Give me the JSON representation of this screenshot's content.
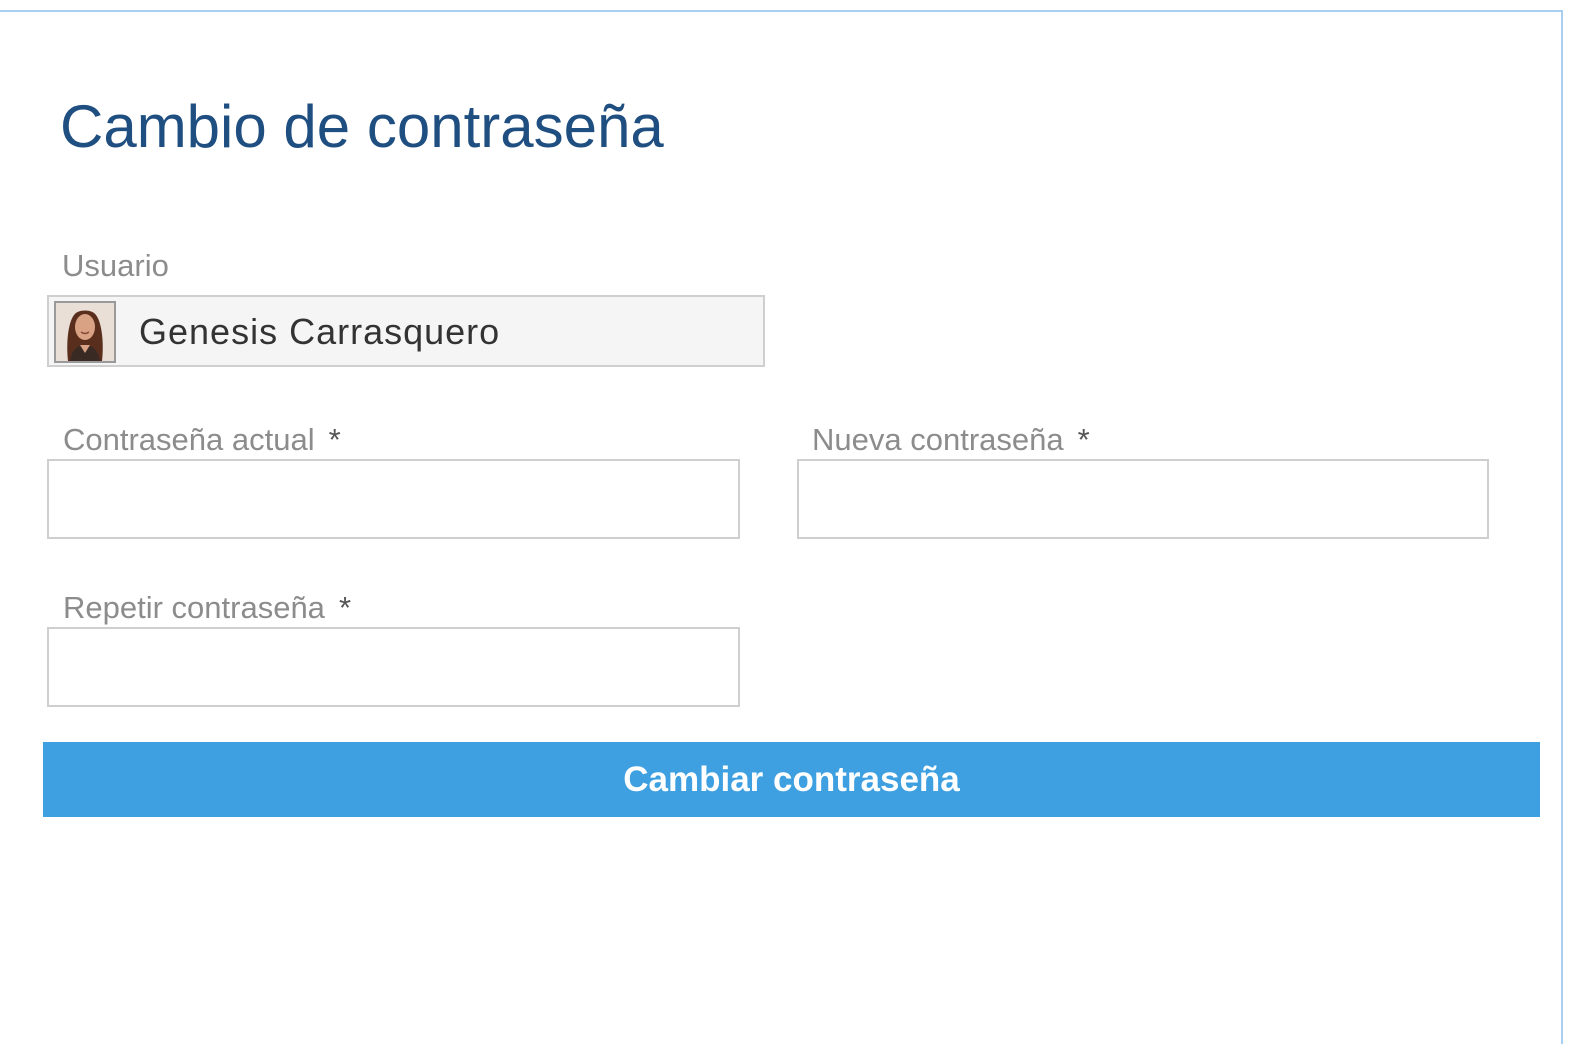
{
  "page": {
    "title": "Cambio de contraseña"
  },
  "user_field": {
    "label": "Usuario",
    "value": "Genesis Carrasquero"
  },
  "current_password": {
    "label": "Contraseña actual",
    "required_mark": "*",
    "value": ""
  },
  "new_password": {
    "label": "Nueva contraseña",
    "required_mark": "*",
    "value": ""
  },
  "repeat_password": {
    "label": "Repetir contraseña",
    "required_mark": "*",
    "value": ""
  },
  "submit": {
    "label": "Cambiar contraseña"
  },
  "colors": {
    "title": "#1f4e80",
    "button": "#3ea0e1",
    "border": "#a9cff0"
  }
}
